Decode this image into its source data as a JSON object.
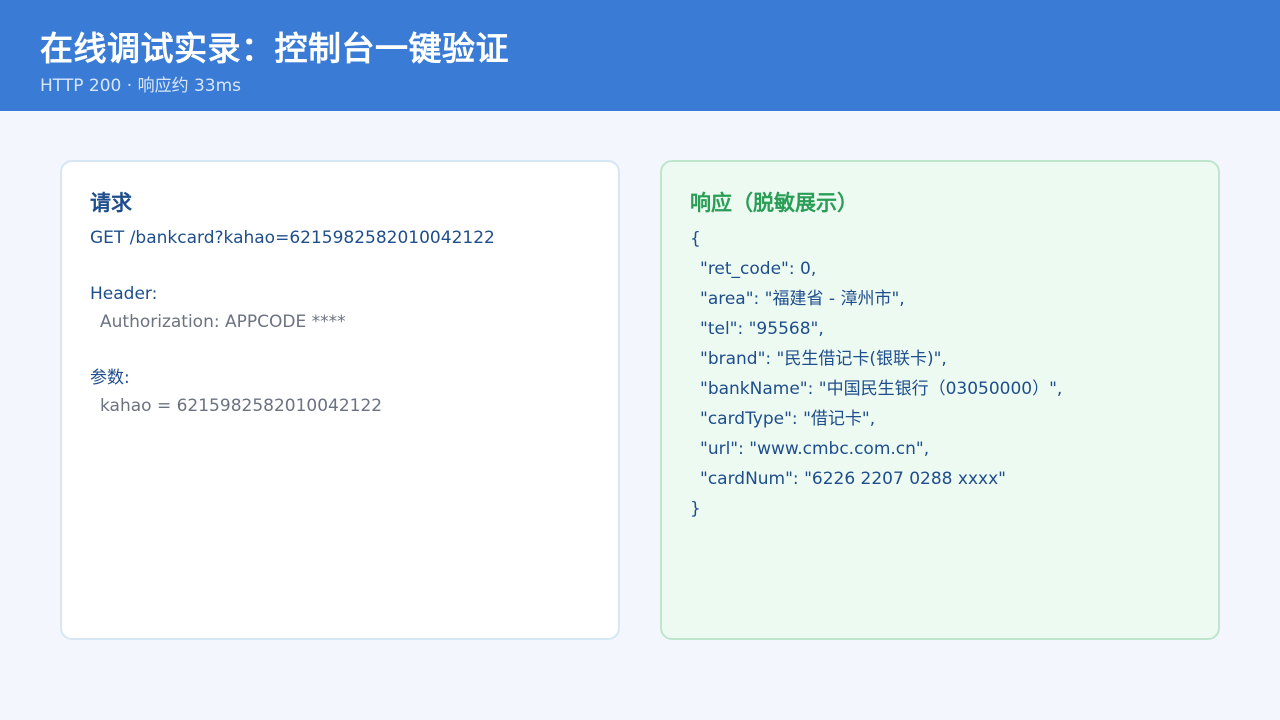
{
  "header": {
    "title": "在线调试实录：控制台一键验证",
    "subtitle": "HTTP 200 · 响应约 33ms"
  },
  "request": {
    "title": "请求",
    "request_line": "GET /bankcard?kahao=6215982582010042122",
    "header_label": "Header:",
    "header_value": "Authorization: APPCODE ****",
    "params_label": "参数:",
    "params_value": "kahao = 6215982582010042122"
  },
  "response": {
    "title": "响应（脱敏展示）",
    "open_brace": "{",
    "lines": [
      "\"ret_code\": 0,",
      "\"area\": \"福建省 - 漳州市\",",
      "\"tel\": \"95568\",",
      "\"brand\": \"民生借记卡(银联卡)\",",
      "\"bankName\": \"中国民生银行（03050000）\",",
      "\"cardType\": \"借记卡\",",
      "\"url\": \"www.cmbc.com.cn\",",
      "\"cardNum\": \"6226 2207 0288 xxxx\""
    ],
    "close_brace": "}"
  },
  "colors": {
    "header_bg": "#3a7bd5",
    "page_bg": "#f3f7fd",
    "request_title": "#1f4e8c",
    "response_title": "#2a9d56",
    "response_card_bg": "#edfaf1"
  }
}
